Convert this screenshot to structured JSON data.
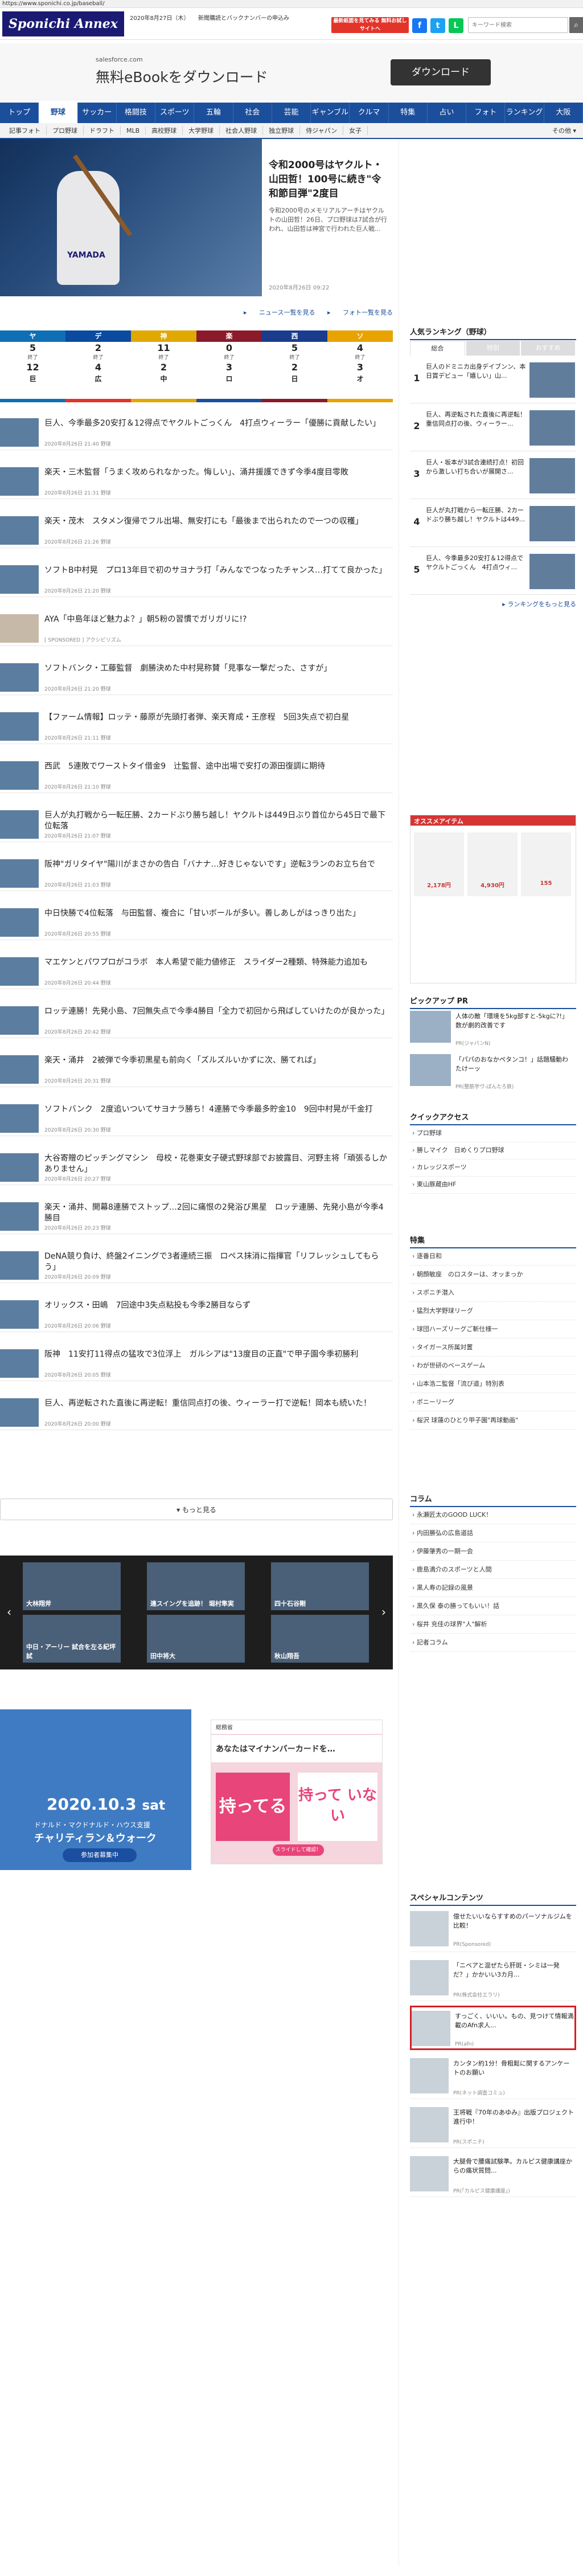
{
  "url": "https://www.sponichi.co.jp/baseball/",
  "header": {
    "logo": "Sponichi Annex",
    "date": "2020年8月27日（木）",
    "news": "新聞購読とバックナンバーの申込み",
    "subscribe": "最新紙面を見てみる 無料お試しサイトへ",
    "search_placeholder": "キーワード検索"
  },
  "top_ad": {
    "sub": "salesforce.com",
    "title": "無料eBookをダウンロード",
    "button": "ダウンロード"
  },
  "nav_main": [
    "トップ",
    "野球",
    "サッカー",
    "格闘技",
    "スポーツ",
    "五輪",
    "社会",
    "芸能",
    "ギャンブル",
    "クルマ",
    "特集",
    "占い",
    "フォト",
    "ランキング",
    "大阪"
  ],
  "nav_sub": [
    "記事フォト",
    "プロ野球",
    "ドラフト",
    "MLB",
    "高校野球",
    "大学野球",
    "社会人野球",
    "独立野球",
    "侍ジャパン",
    "女子"
  ],
  "nav_sub_more": "その他",
  "hero": {
    "title": "令和2000号はヤクルト・山田哲！100号に続き\"令和節目弾\"2度目",
    "lead": "令和2000号のメモリアルアーチはヤクルトの山田哲！26日、プロ野球は7試合が行われ、山田哲は神宮で行われた巨人戦...",
    "date": "2020年8月26日 09:22",
    "uniform": "YAMADA"
  },
  "score_links": [
    "ニュース一覧を見る",
    "フォト一覧を見る"
  ],
  "scores": [
    {
      "team": "ヤ",
      "color": "#0f6fb5",
      "a": "5",
      "status": "終了",
      "b": "12",
      "opp": "巨"
    },
    {
      "team": "デ",
      "color": "#0a4aa0",
      "a": "2",
      "status": "終了",
      "b": "4",
      "opp": "広"
    },
    {
      "team": "神",
      "color": "#e0a800",
      "a": "11",
      "status": "終了",
      "b": "2",
      "opp": "中"
    },
    {
      "team": "楽",
      "color": "#8b1a2a",
      "a": "0",
      "status": "終了",
      "b": "3",
      "opp": "ロ"
    },
    {
      "team": "西",
      "color": "#1a3c8c",
      "a": "5",
      "status": "終了",
      "b": "2",
      "opp": "日"
    },
    {
      "team": "ソ",
      "color": "#e8a300",
      "a": "4",
      "status": "終了",
      "b": "3",
      "opp": "オ"
    }
  ],
  "articles": [
    {
      "title": "巨人、今季最多20安打＆12得点でヤクルトごっくん　4打点ウィーラー「優勝に貢献したい」",
      "meta": "2020年8月26日 21:40 野球"
    },
    {
      "title": "楽天・三木監督「うまく攻められなかった。悔しい」、涌井援護できず今季4度目零敗",
      "meta": "2020年8月26日 21:31 野球"
    },
    {
      "title": "楽天・茂木　スタメン復帰でフル出場、無安打にも「最後まで出られたので一つの収穫」",
      "meta": "2020年8月26日 21:26 野球"
    },
    {
      "title": "ソフトB中村晃　プロ13年目で初のサヨナラ打「みんなでつなったチャンス…打てて良かった」",
      "meta": "2020年8月26日 21:20 野球"
    },
    {
      "title": "AYA「中島年ほど魅力よ？」朝5粉の習慣でガリガリに!?",
      "meta": "[ SPONSORED ] アクシビリズム"
    },
    {
      "title": "ソフトバンク・工藤監督　劇勝決めた中村晃称賛「見事な一撃だった、さすが」",
      "meta": "2020年8月26日 21:20 野球"
    },
    {
      "title": "【ファーム情報】ロッテ・藤原が先頭打者弾、楽天育成・王彦程　5回3失点で初白星",
      "meta": "2020年8月26日 21:11 野球"
    },
    {
      "title": "西武　5連敗でワーストタイ借金9　辻監督、途中出場で安打の源田復調に期待",
      "meta": "2020年8月26日 21:10 野球"
    },
    {
      "title": "巨人が丸打戦から一転圧勝、2カードぶり勝ち越し！ヤクルトは449日ぶり首位から45日で最下位転落",
      "meta": "2020年8月26日 21:07 野球"
    },
    {
      "title": "阪神\"ガリタイヤ\"陽川がまさかの告白「バナナ…好きじゃないです」逆転3ランのお立ち台で",
      "meta": "2020年8月26日 21:03 野球"
    },
    {
      "title": "中日快勝で4位転落　与田監督、複合に「甘いボールが多い。善しあしがはっきり出た」",
      "meta": "2020年8月26日 20:55 野球"
    },
    {
      "title": "マエケンとパワプロがコラボ　本人希望で能力値修正　スライダー2種類、特殊能力追加も",
      "meta": "2020年8月26日 20:44 野球"
    },
    {
      "title": "ロッテ連勝！先発小島、7回無失点で今季4勝目「全力で初回から飛ばしていけたのが良かった」",
      "meta": "2020年8月26日 20:42 野球"
    },
    {
      "title": "楽天・涌井　2被弾で今季初黒星も前向く「ズルズルいかずに次、勝てれば」",
      "meta": "2020年8月26日 20:31 野球"
    },
    {
      "title": "ソフトバンク　2度追いついてサヨナラ勝ち！4連勝で今季最多貯金10　9回中村晃が千金打",
      "meta": "2020年8月26日 20:30 野球"
    },
    {
      "title": "大谷寄贈のピッチングマシン　母校・花巻東女子硬式野球部でお披露目、河野主将「頑張るしかありません」",
      "meta": "2020年8月26日 20:27 野球"
    },
    {
      "title": "楽天・涌井、開幕8連勝でストップ…2回に痛恨の2発浴び黒星　ロッテ連勝、先発小島が今季4勝目",
      "meta": "2020年8月26日 20:23 野球"
    },
    {
      "title": "DeNA競り負け、終盤2イニングで3者連続三振　ロペス抹消に指揮官「リフレッシュしてもらう」",
      "meta": "2020年8月26日 20:09 野球"
    },
    {
      "title": "オリックス・田嶋　7回途中3失点粘投も今季2勝目ならず",
      "meta": "2020年8月26日 20:06 野球"
    },
    {
      "title": "阪神　11安打11得点の猛攻で3位浮上　ガルシアは\"13度目の正直\"で甲子園今季初勝利",
      "meta": "2020年8月26日 20:05 野球"
    },
    {
      "title": "巨人、再逆転された直後に再逆転！重信同点打の後、ウィーラー打で逆転！岡本も続いた！",
      "meta": "2020年8月26日 20:00 野球"
    }
  ],
  "more_label": "もっと見る",
  "carousel": [
    "大林翔斧",
    "連スイングを追跡！ 堀村隼実",
    "田中将大",
    "四十石谷剛",
    "秋山翔吾",
    "中日・アーリー 試合を左る紀坪試"
  ],
  "ad1": {
    "date": "2020.10.3",
    "day": "sat",
    "sub": "ドナルド・マクドナルド・ハウス支援",
    "big": "チャリティラン＆ウォーク",
    "btn": "参加者募集中"
  },
  "ad2": {
    "top": "総務省",
    "mid": "あなたはマイナンバーカードを…",
    "left": "持ってる",
    "right": "持って いない",
    "pill": "スライドして確認！"
  },
  "sidebar": {
    "ranking_title": "人気ランキング（野球）",
    "ranking_tabs": [
      "総合",
      "特別",
      "おすすめ"
    ],
    "ranking": [
      {
        "no": "1",
        "text": "巨人のドミニカ出身デイブンン、本日賞デビュー「嬉しい」山..."
      },
      {
        "no": "2",
        "text": "巨人、再逆転された直後に再逆転！重信同点打の後、ウィーラー..."
      },
      {
        "no": "3",
        "text": "巨人・坂本が3試合連続打点！初回から激しい打ち合いが展開さ..."
      },
      {
        "no": "4",
        "text": "巨人が丸打戦から一転圧勝、2カードぶり勝ち越し！ヤクルトは449..."
      },
      {
        "no": "5",
        "text": "巨人、今季最多20安打＆12得点でヤクルトごっくん　4打点ウィ..."
      }
    ],
    "ranking_more": "ランキングをもっと見る",
    "osusume_title": "オススメアイテム",
    "osusume": [
      "2,178円",
      "4,930円",
      "155"
    ],
    "pickup_title": "ピックアップ PR",
    "pickup": [
      {
        "text": "人体の敵「環境を5kg部すと-5kgに?!」数が劇的改善です",
        "pr": "PR(ジャパンN)"
      },
      {
        "text": "「パパのおなかペタンコ！」話題騒動わたけーッ",
        "pr": "PR(整筋学ヴ-ぽんたろ鉄)"
      }
    ],
    "quick_title": "クイックアクセス",
    "quick": [
      "プロ野球",
      "勝しマイク　日めくりプロ野球",
      "カレッジスポーツ",
      "東山豚蔵由HF"
    ],
    "feature_title": "特集",
    "features": [
      "逐番日和",
      "朝顔敏座　のロスターは、オッまっか",
      "スポニチ潜入",
      "猛烈大学野球リーグ",
      "球団ハーズリーグご斬仕様一",
      "タイガース所属対置",
      "わが世研のベースゲーム",
      "山本浩二監督「流び道」特別表",
      "ボニーリーグ",
      "桜沢 球蓮のひとり甲子園\"再球動画\""
    ],
    "column_title": "コラム",
    "columns": [
      "永瀬匠太のGOOD LUCK！",
      "内田勝弘の広島道話",
      "伊藤肇秀の一期一会",
      "鹿島満介のスポーツと人間",
      "黒人寿の記録の風景",
      "黒久保 泰の勝ってもいい！話",
      "桜井 充佳の球界\"人\"解析",
      "記者コラム"
    ],
    "special_title": "スペシャルコンテンツ",
    "special": [
      {
        "text": "億せたいいならすすめのパーソナルジムを比較！",
        "pr": "PR(Sponsored)"
      },
      {
        "text": "「ニベアと混ぜたら肝斑・シミは一発だ？」かかいい3カ月...",
        "pr": "PR(株式会社エラリ)"
      },
      {
        "text": "すっごく、いいい。もの、見つけて情報満載のAfn求人...",
        "pr": "PR(afn)"
      },
      {
        "text": "カンタン約1分！骨粗鬆に関するアンケートのお願い",
        "pr": "PR(ネット調査コミュ)"
      },
      {
        "text": "王将戦『70年のあゆみ』出版プロジェクト進行中！",
        "pr": "PR(スポニチ)"
      },
      {
        "text": "大腿骨で腰痛試験準。カルピス健康講座からの痛状質問...",
        "pr": "PR(「カルピス健康講座」)"
      }
    ]
  }
}
